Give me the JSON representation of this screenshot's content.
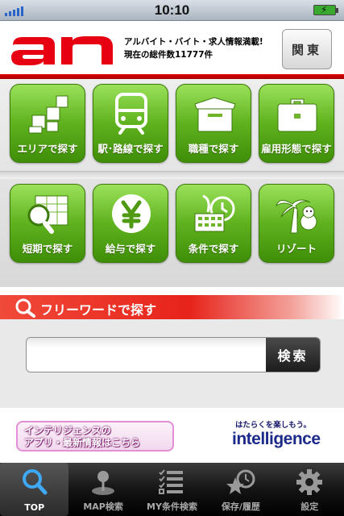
{
  "status_bar": {
    "time": "10:10"
  },
  "header": {
    "brand": "an",
    "tagline": "アルバイト・バイト・求人情報満載!",
    "count_text": "現在の総件数11777件",
    "region_button": "関東"
  },
  "categories": [
    {
      "label": "エリアで探す",
      "icon": "area-blocks-icon"
    },
    {
      "label": "駅･路線で探す",
      "icon": "train-icon"
    },
    {
      "label": "職種で探す",
      "icon": "box-icon"
    },
    {
      "label": "雇用形態で探す",
      "icon": "briefcase-icon"
    },
    {
      "label": "短期で探す",
      "icon": "calendar-magnifier-icon"
    },
    {
      "label": "給与で探す",
      "icon": "yen-coin-icon"
    },
    {
      "label": "条件で探す",
      "icon": "keyboard-clock-icon"
    },
    {
      "label": "リゾート",
      "icon": "palm-tree-icon"
    }
  ],
  "search": {
    "title": "フリーワードで探す",
    "input_value": "",
    "placeholder": "",
    "button": "検索"
  },
  "banners": {
    "app_banner_line1": "インテリジェンスの",
    "app_banner_line2": "アプリ・最新情報はこちら",
    "intel_tagline": "はたらくを楽しもう。",
    "intel_logo": "intelligence"
  },
  "tabs": [
    {
      "label": "TOP",
      "icon": "search-icon",
      "active": true
    },
    {
      "label": "MAP検索",
      "icon": "map-pin-icon",
      "active": false
    },
    {
      "label": "MY条件検索",
      "icon": "checklist-icon",
      "active": false
    },
    {
      "label": "保存/履歴",
      "icon": "star-clock-icon",
      "active": false
    },
    {
      "label": "設定",
      "icon": "gear-icon",
      "active": false
    }
  ],
  "colors": {
    "brand_red": "#e10000",
    "tile_green": "#5fb21e",
    "tab_bar": "#141414"
  }
}
